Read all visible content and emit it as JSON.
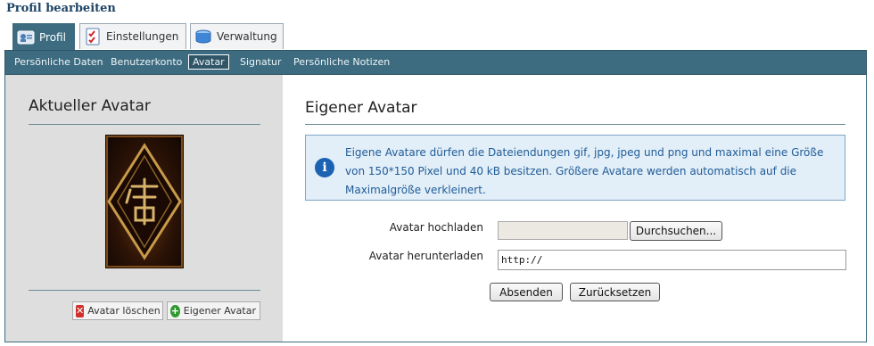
{
  "page_title": "Profil bearbeiten",
  "tabs": [
    {
      "label": "Profil",
      "icon": "profile-card-icon",
      "active": true
    },
    {
      "label": "Einstellungen",
      "icon": "checklist-icon",
      "active": false
    },
    {
      "label": "Verwaltung",
      "icon": "database-icon",
      "active": false
    }
  ],
  "subnav": [
    {
      "label": "Persönliche Daten",
      "active": false
    },
    {
      "label": "Benutzerkonto",
      "active": false
    },
    {
      "label": "Avatar",
      "active": true
    },
    {
      "label": "Signatur",
      "active": false
    },
    {
      "label": "Persönliche Notizen",
      "active": false
    }
  ],
  "left": {
    "title": "Aktueller Avatar",
    "delete_label": "Avatar löschen",
    "own_label": "Eigener Avatar"
  },
  "right": {
    "title": "Eigener Avatar",
    "info": "Eigene Avatare dürfen die Dateiendungen gif, jpg, jpeg und png und maximal eine Größe von 150*150 Pixel und 40 kB besitzen. Größere Avatare werden automatisch auf die Maximalgröße verkleinert.",
    "upload_label": "Avatar hochladen",
    "browse_label": "Durchsuchen...",
    "download_label": "Avatar herunterladen",
    "url_value": "http://",
    "submit_label": "Absenden",
    "reset_label": "Zurücksetzen"
  },
  "colors": {
    "nav_bg": "#3d6c80",
    "info_bg": "#e2eef8",
    "info_text": "#1f5c97",
    "left_panel_bg": "#dedede"
  }
}
